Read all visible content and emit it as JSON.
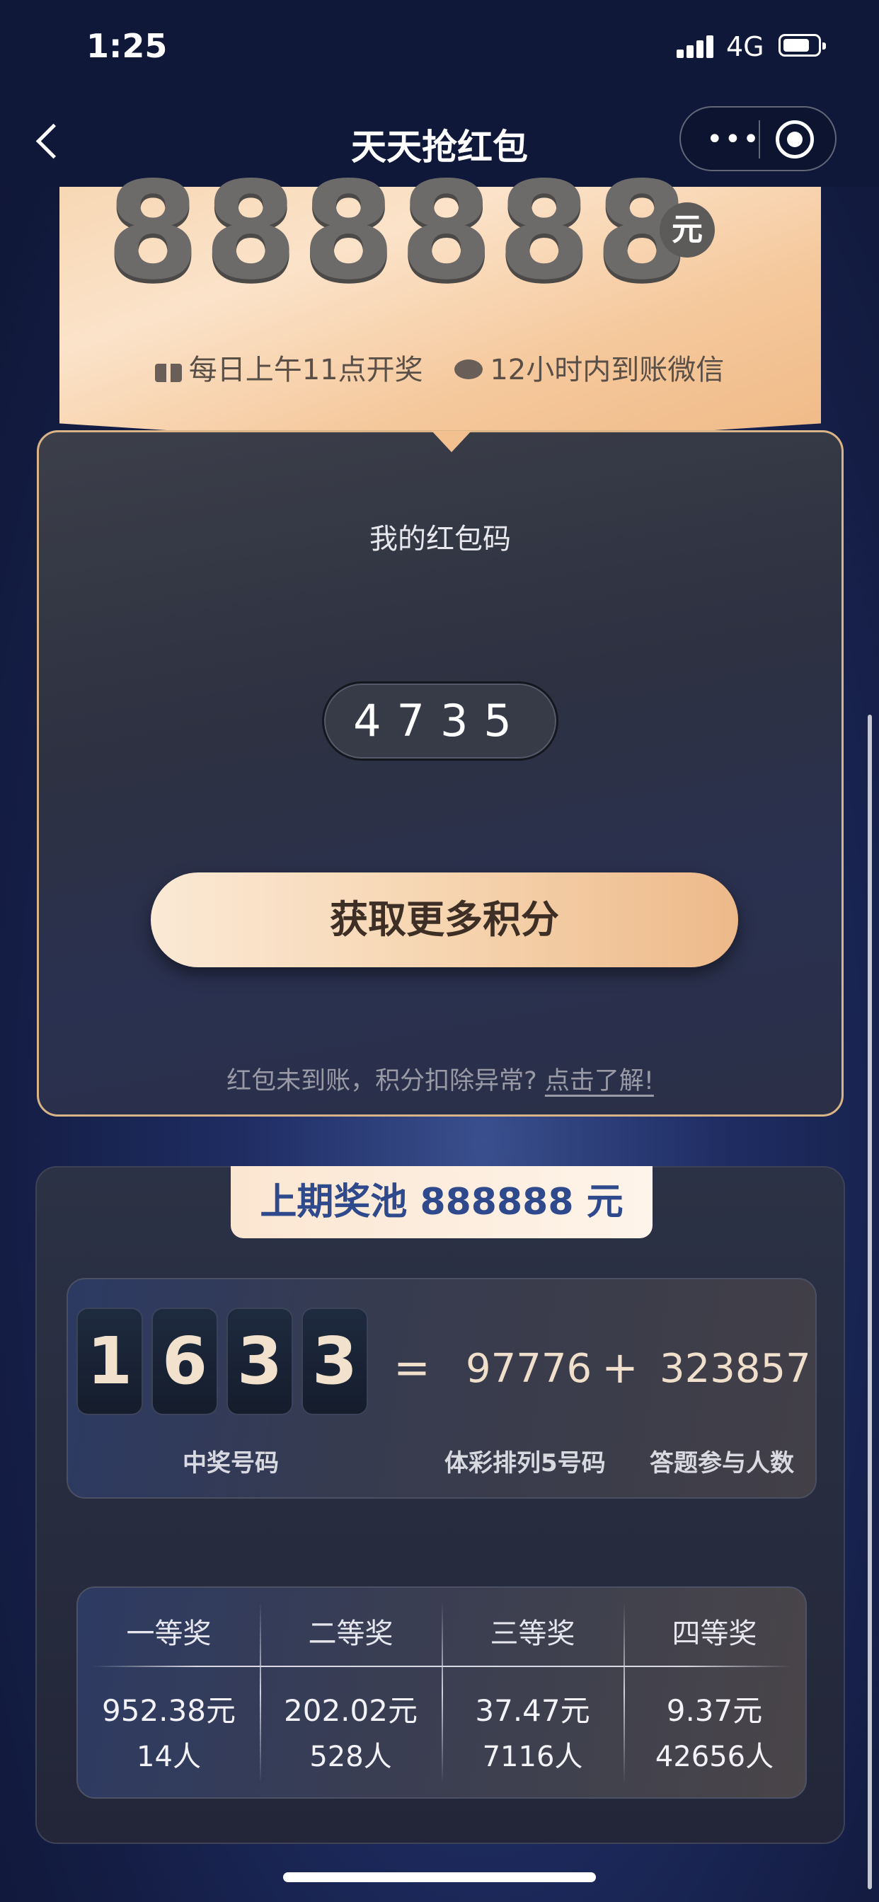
{
  "status_bar": {
    "time": "1:25",
    "network": "4G"
  },
  "nav": {
    "title": "天天抢红包",
    "more_icon": "•••"
  },
  "banner": {
    "amount": "888888",
    "currency": "元",
    "info_draw": "每日上午11点开奖",
    "info_payout": "12小时内到账微信"
  },
  "code_card": {
    "title": "我的红包码",
    "code": "4735",
    "button_label": "获取更多积分",
    "note_prefix": "红包未到账，积分扣除异常?",
    "note_link": "点击了解!"
  },
  "pool": {
    "tab_label": "上期奖池 888888 元",
    "winning_digits": [
      "1",
      "6",
      "3",
      "3"
    ],
    "equals": "=",
    "plus": "+",
    "lottery_number": "97776",
    "participants": "323857",
    "label_winning": "中奖号码",
    "label_lottery": "体彩排列5号码",
    "label_participants": "答题参与人数",
    "tiers": [
      {
        "name": "一等奖",
        "amount": "952.38元",
        "people": "14人"
      },
      {
        "name": "二等奖",
        "amount": "202.02元",
        "people": "528人"
      },
      {
        "name": "三等奖",
        "amount": "37.47元",
        "people": "7116人"
      },
      {
        "name": "四等奖",
        "amount": "9.37元",
        "people": "42656人"
      }
    ]
  }
}
